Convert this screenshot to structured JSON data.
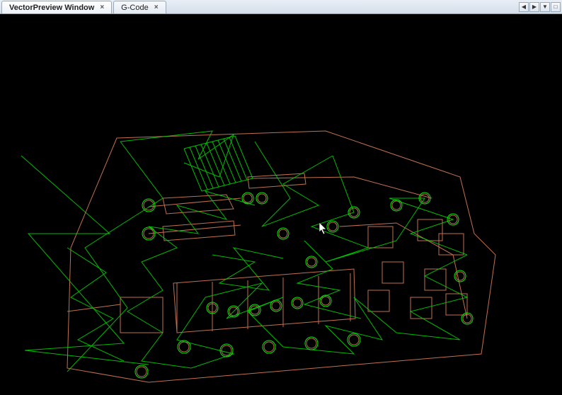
{
  "tabs": [
    {
      "label": "VectorPreview Window",
      "active": true
    },
    {
      "label": "G-Code",
      "active": false
    }
  ],
  "controls": {
    "prev": "◀",
    "next": "▶",
    "menu": "▼",
    "close": "□"
  },
  "preview": {
    "board_outline_color": "#d08060",
    "milling_path_color": "#00e000",
    "rapid_path_color": "#00a000",
    "background": "#000000"
  }
}
